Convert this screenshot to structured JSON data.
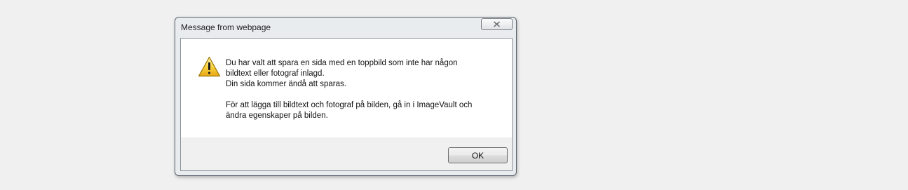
{
  "dialog": {
    "title": "Message from webpage",
    "close_icon": "close-icon",
    "warning_icon": "warning-icon",
    "message_lines": [
      "Du har valt att spara en sida med en toppbild som inte har någon",
      "bildtext eller fotograf inlagd.",
      "Din sida kommer ändå att sparas.",
      "För att lägga till bildtext och fotograf på bilden, gå in i ImageVault och",
      "ändra egenskaper på bilden."
    ],
    "ok_label": "OK"
  }
}
